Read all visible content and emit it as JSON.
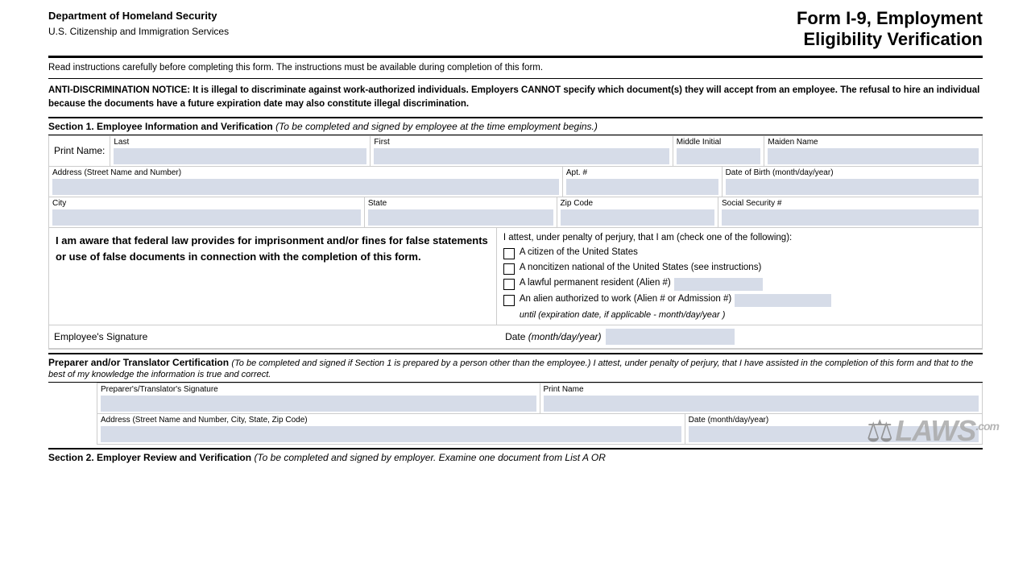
{
  "header": {
    "dept_line1": "Department of Homeland Security",
    "dept_line2": "U.S. Citizenship and Immigration Services",
    "form_title_line1": "Form I-9, Employment",
    "form_title_line2": "Eligibility Verification"
  },
  "notices": {
    "read_instruction": "Read instructions carefully before completing this form.  The instructions must be available during completion of this form.",
    "anti_disc_bold": "ANTI-DISCRIMINATION NOTICE:  It is illegal to discriminate against work-authorized individuals. Employers CANNOT specify which document(s) they will accept from an employee.  The refusal to hire an individual because the documents have  a future expiration date may also constitute illegal discrimination."
  },
  "section1": {
    "header": "Section 1. Employee Information and Verification",
    "header_italic": "(To be completed and signed by employee at the time employment begins.)",
    "print_name_label": "Print Name:",
    "last_label": "Last",
    "first_label": "First",
    "middle_initial_label": "Middle Initial",
    "maiden_name_label": "Maiden Name",
    "address_label": "Address",
    "address_italic": "(Street Name and Number)",
    "apt_label": "Apt. #",
    "dob_label": "Date of Birth",
    "dob_italic": "(month/day/year)",
    "city_label": "City",
    "state_label": "State",
    "zip_label": "Zip Code",
    "ssn_label": "Social Security #",
    "attest_left_text": "I am aware that federal law provides for imprisonment and/or fines for false statements or use of false documents in connection with the completion of this form.",
    "attest_right_title": "I attest, under penalty of perjury, that I am (check one of the following):",
    "checkbox1": "A citizen of the United States",
    "checkbox2": "A noncitizen national of the United States (see instructions)",
    "checkbox3_pre": "A lawful permanent resident (Alien #)",
    "checkbox4_pre": "An alien authorized to work (Alien # or Admission #)",
    "checkbox4_until": "until (expiration date, if applicable -",
    "checkbox4_until_italic": "month/day/year",
    "checkbox4_until_end": ")",
    "emp_sig_label": "Employee's Signature",
    "date_label": "Date",
    "date_italic": "(month/day/year)"
  },
  "preparer": {
    "header_bold": "Preparer and/or Translator Certification",
    "header_italic": "(To be completed and signed if Section 1 is prepared by a person other than the employee.) I attest, under penalty of perjury, that I have assisted in the completion of this form and that to the best of my knowledge the information is true and correct.",
    "sig_label": "Preparer's/Translator's Signature",
    "print_name_label": "Print Name",
    "address_label": "Address",
    "address_italic": "(Street Name and Number, City, State, Zip Code)",
    "date_label": "Date",
    "date_italic": "(month/day/year)"
  },
  "section2": {
    "header": "Section 2. Employer Review and Verification",
    "header_italic": "(To be completed and signed by employer. Examine one document from List A OR"
  },
  "watermark": {
    "icon": "⚖",
    "text": "LAWS",
    "com": ".com"
  }
}
